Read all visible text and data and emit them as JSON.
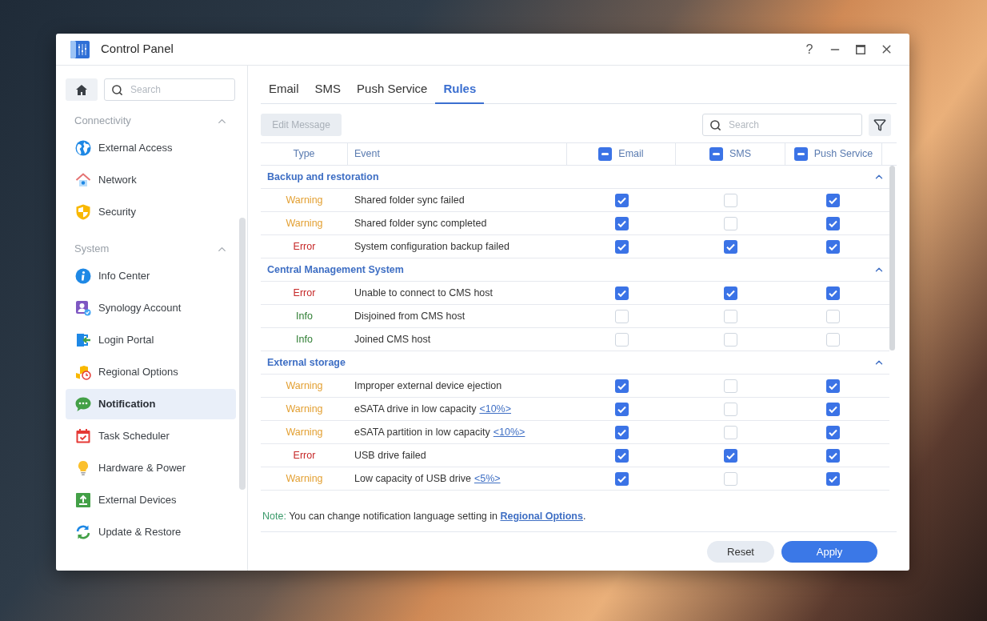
{
  "window": {
    "title": "Control Panel",
    "help": "?"
  },
  "sidebar": {
    "search": {
      "placeholder": "Search"
    },
    "sections": [
      {
        "title": "Connectivity",
        "expanded": true,
        "items": [
          {
            "label": "External Access",
            "selected": false
          },
          {
            "label": "Network",
            "selected": false
          },
          {
            "label": "Security",
            "selected": false
          }
        ]
      },
      {
        "title": "System",
        "expanded": true,
        "items": [
          {
            "label": "Info Center",
            "selected": false
          },
          {
            "label": "Synology Account",
            "selected": false
          },
          {
            "label": "Login Portal",
            "selected": false
          },
          {
            "label": "Regional Options",
            "selected": false
          },
          {
            "label": "Notification",
            "selected": true
          },
          {
            "label": "Task Scheduler",
            "selected": false
          },
          {
            "label": "Hardware & Power",
            "selected": false
          },
          {
            "label": "External Devices",
            "selected": false
          },
          {
            "label": "Update & Restore",
            "selected": false
          }
        ]
      }
    ]
  },
  "tabs": [
    {
      "label": "Email",
      "selected": false
    },
    {
      "label": "SMS",
      "selected": false
    },
    {
      "label": "Push Service",
      "selected": false
    },
    {
      "label": "Rules",
      "selected": true
    }
  ],
  "toolbar": {
    "edit_button": {
      "label": "Edit Message",
      "disabled": true
    },
    "search": {
      "placeholder": "Search"
    }
  },
  "table": {
    "columns": [
      {
        "label": "Type"
      },
      {
        "label": "Event"
      },
      {
        "label": "Email",
        "indeterminate": true
      },
      {
        "label": "SMS",
        "indeterminate": true
      },
      {
        "label": "Push Service",
        "indeterminate": true
      }
    ],
    "groups": [
      {
        "title": "Backup and restoration",
        "expanded": true,
        "rows": [
          {
            "type": "Warning",
            "kind": "warning",
            "event": "Shared folder sync failed",
            "checks": [
              true,
              false,
              true
            ]
          },
          {
            "type": "Warning",
            "kind": "warning",
            "event": "Shared folder sync completed",
            "checks": [
              true,
              false,
              true
            ]
          },
          {
            "type": "Error",
            "kind": "error",
            "event": "System configuration backup failed",
            "checks": [
              true,
              true,
              true
            ]
          }
        ]
      },
      {
        "title": "Central Management System",
        "expanded": true,
        "rows": [
          {
            "type": "Error",
            "kind": "error",
            "event": "Unable to connect to CMS host",
            "checks": [
              true,
              true,
              true
            ]
          },
          {
            "type": "Info",
            "kind": "info",
            "event": "Disjoined from CMS host",
            "checks": [
              false,
              false,
              false
            ]
          },
          {
            "type": "Info",
            "kind": "info",
            "event": "Joined CMS host",
            "checks": [
              false,
              false,
              false
            ]
          }
        ]
      },
      {
        "title": "External storage",
        "expanded": true,
        "rows": [
          {
            "type": "Warning",
            "kind": "warning",
            "event": "Improper external device ejection",
            "checks": [
              true,
              false,
              true
            ]
          },
          {
            "type": "Warning",
            "kind": "warning",
            "event": "eSATA drive in low capacity",
            "link": "<10%>",
            "checks": [
              true,
              false,
              true
            ]
          },
          {
            "type": "Warning",
            "kind": "warning",
            "event": "eSATA partition in low capacity",
            "link": "<10%>",
            "checks": [
              true,
              false,
              true
            ]
          },
          {
            "type": "Error",
            "kind": "error",
            "event": "USB drive failed",
            "checks": [
              true,
              true,
              true
            ]
          },
          {
            "type": "Warning",
            "kind": "warning",
            "event": "Low capacity of USB drive",
            "link": "<5%>",
            "checks": [
              true,
              false,
              true
            ]
          }
        ]
      }
    ]
  },
  "note": {
    "label": "Note:",
    "text": "You can change notification language setting in",
    "link": "Regional Options",
    "end": "."
  },
  "buttons": {
    "reset": "Reset",
    "apply": "Apply"
  }
}
